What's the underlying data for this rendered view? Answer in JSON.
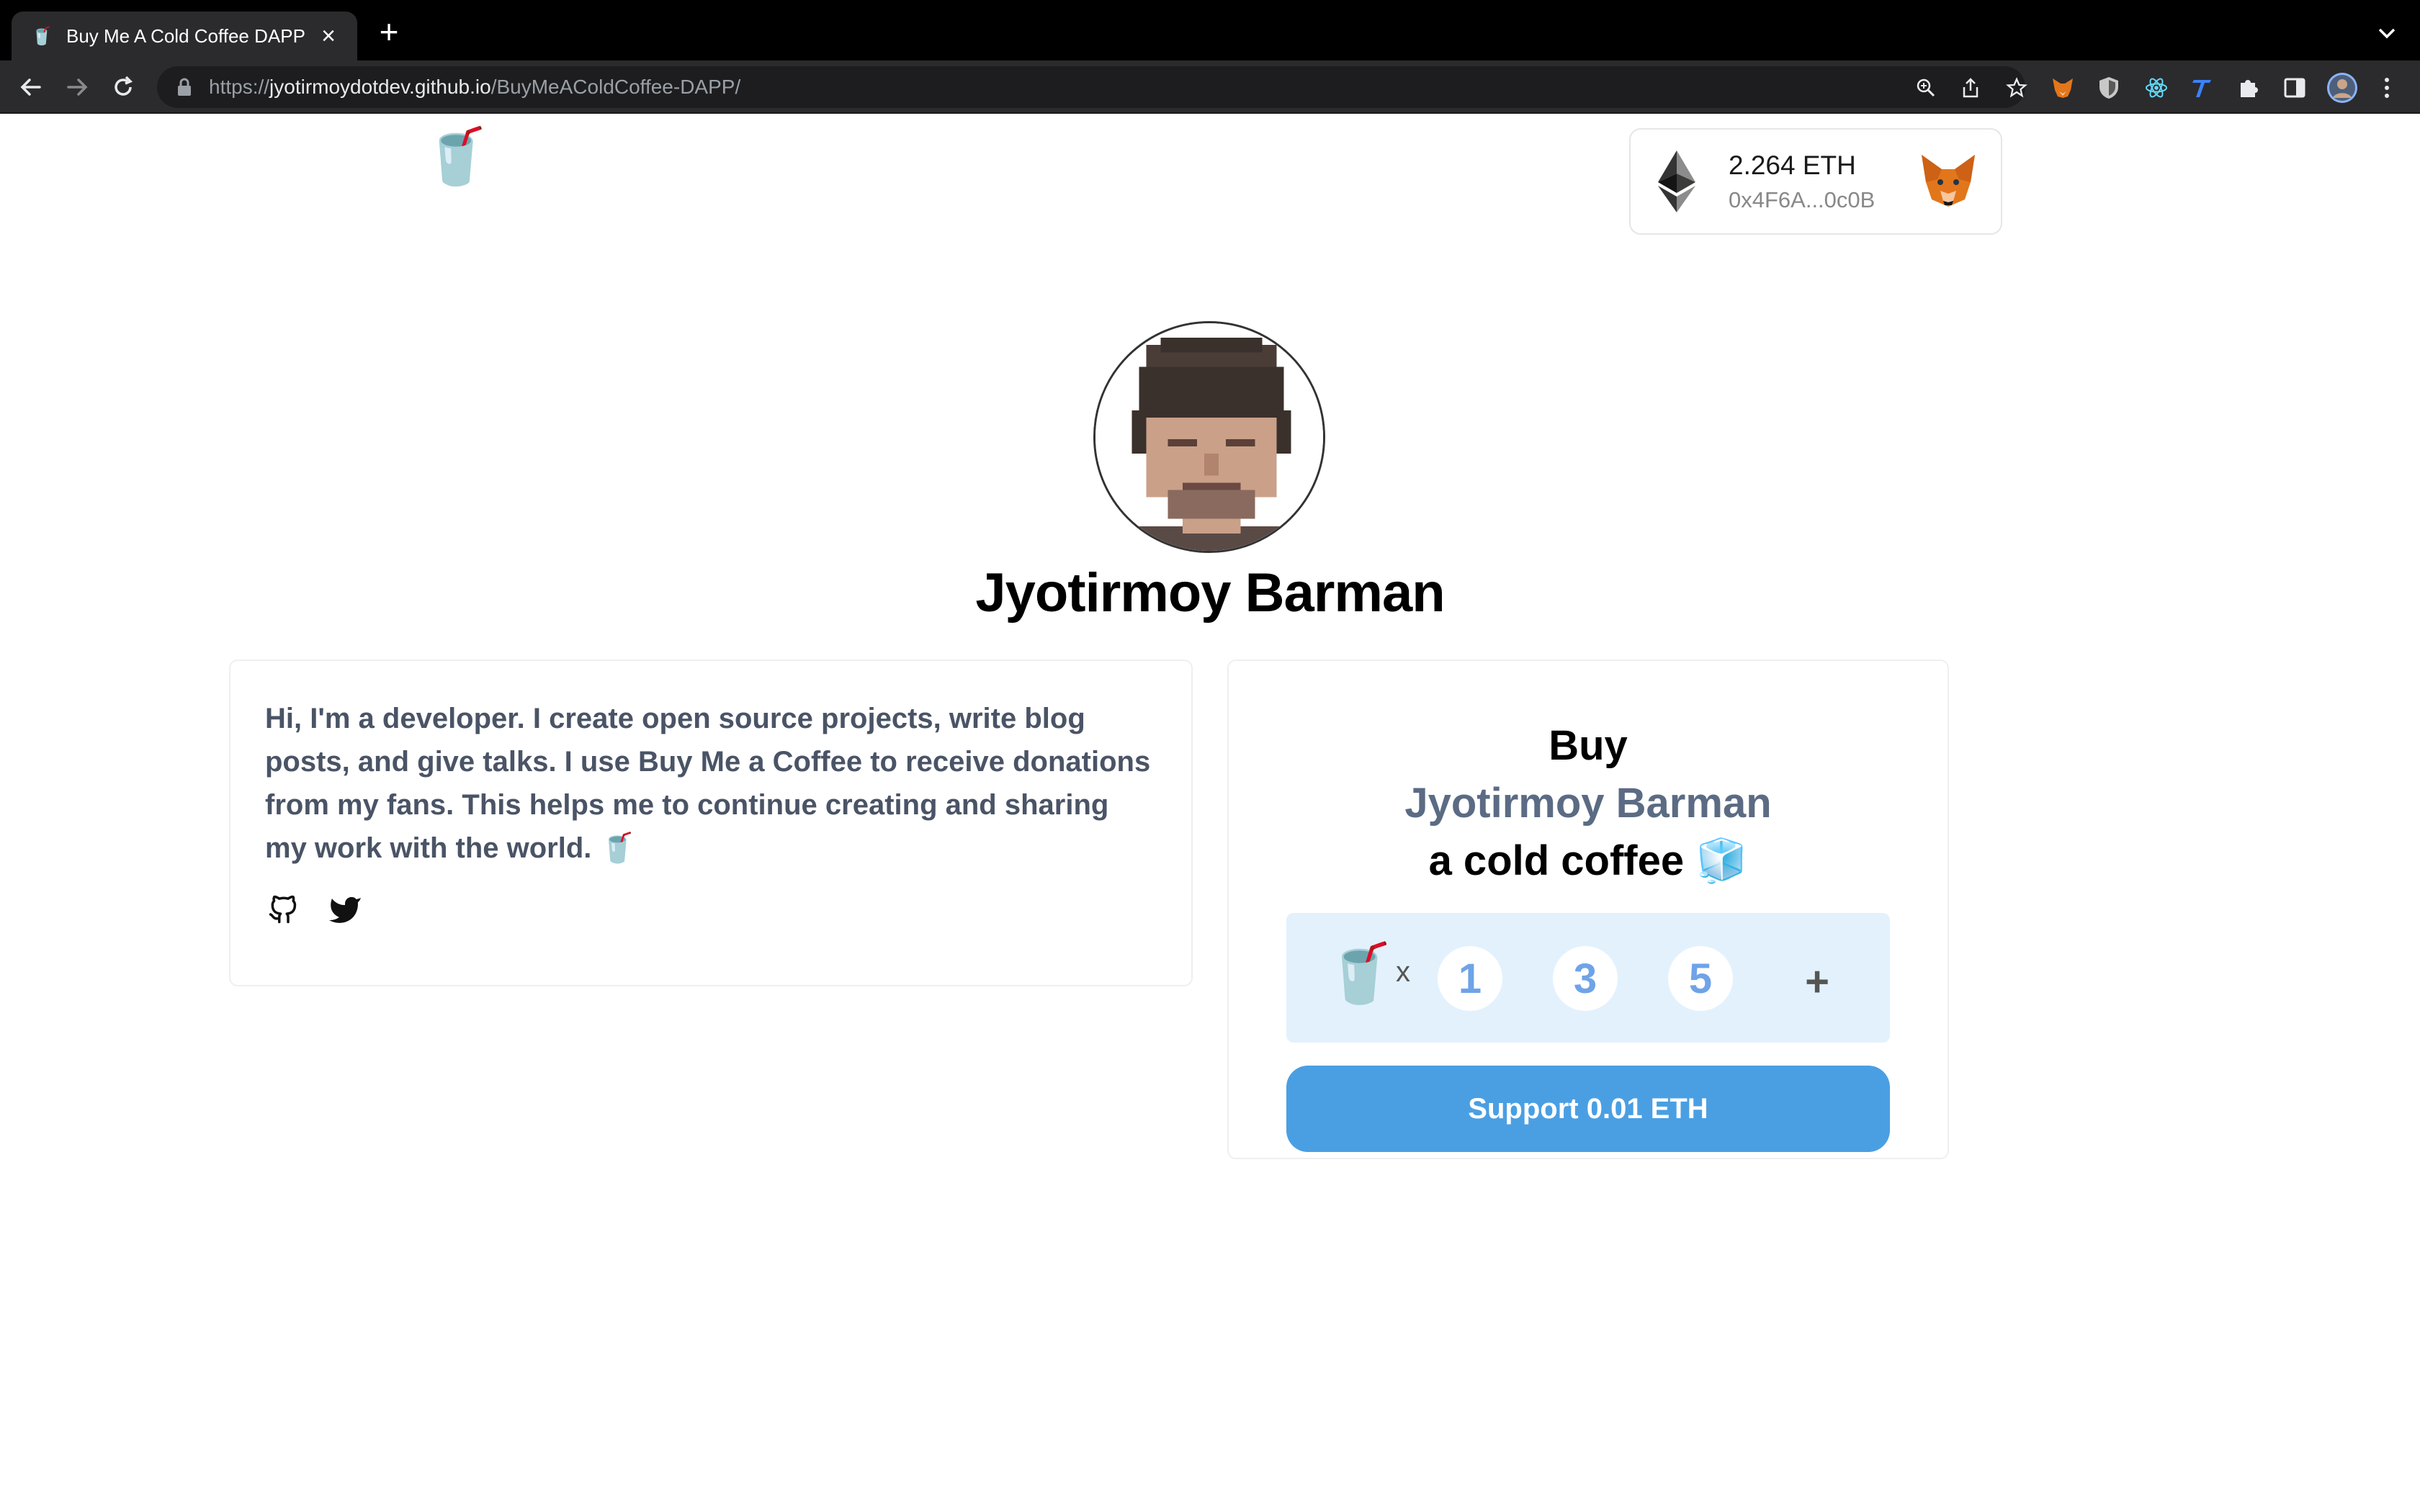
{
  "browser": {
    "tab": {
      "title": "Buy Me A Cold Coffee DAPP",
      "favicon": "cold-coffee-cup",
      "close_label": "×"
    },
    "new_tab_label": "+",
    "url": {
      "scheme": "https://",
      "host": "jyotirmoydotdev.github.io",
      "path": "/BuyMeAColdCoffee-DAPP/"
    }
  },
  "header": {
    "logo": "🥤",
    "wallet": {
      "balance": "2.264 ETH",
      "address": "0x4F6A...0c0B"
    }
  },
  "profile": {
    "name": "Jyotirmoy Barman"
  },
  "about": {
    "text": "Hi, I'm a developer. I create open source projects, write blog posts, and give talks. I use Buy Me a Coffee to receive donations from my fans. This helps me to continue creating and sharing my work with the world. 🥤",
    "social": [
      "github-icon",
      "twitter-icon"
    ]
  },
  "support": {
    "heading_line1": "Buy",
    "heading_creator": "Jyotirmoy Barman",
    "heading_line3": "a cold coffee 🧊",
    "cup": "🥤",
    "multiplier": "x",
    "options": [
      "1",
      "3",
      "5"
    ],
    "custom_label": "+",
    "button_label": "Support 0.01 ETH"
  },
  "colors": {
    "accent_button": "#4a9fe3",
    "quantity_bg": "#e3f1fd",
    "quantity_text": "#6fa3e8",
    "creator_text": "#5b6b84",
    "about_text": "#4a5466"
  }
}
